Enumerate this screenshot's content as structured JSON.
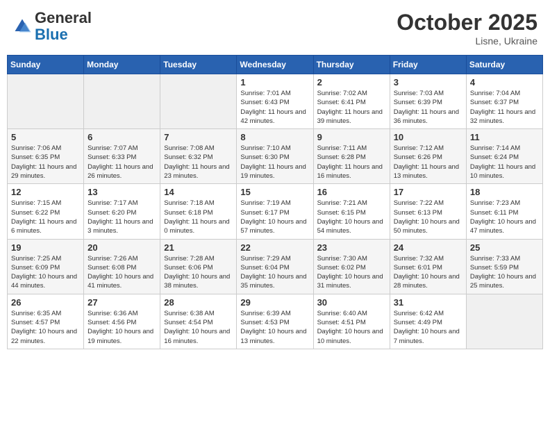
{
  "header": {
    "logo": {
      "line1": "General",
      "line2": "Blue"
    },
    "title": "October 2025",
    "location": "Lisne, Ukraine"
  },
  "weekdays": [
    "Sunday",
    "Monday",
    "Tuesday",
    "Wednesday",
    "Thursday",
    "Friday",
    "Saturday"
  ],
  "weeks": [
    [
      {
        "day": "",
        "sunrise": "",
        "sunset": "",
        "daylight": ""
      },
      {
        "day": "",
        "sunrise": "",
        "sunset": "",
        "daylight": ""
      },
      {
        "day": "",
        "sunrise": "",
        "sunset": "",
        "daylight": ""
      },
      {
        "day": "1",
        "sunrise": "Sunrise: 7:01 AM",
        "sunset": "Sunset: 6:43 PM",
        "daylight": "Daylight: 11 hours and 42 minutes."
      },
      {
        "day": "2",
        "sunrise": "Sunrise: 7:02 AM",
        "sunset": "Sunset: 6:41 PM",
        "daylight": "Daylight: 11 hours and 39 minutes."
      },
      {
        "day": "3",
        "sunrise": "Sunrise: 7:03 AM",
        "sunset": "Sunset: 6:39 PM",
        "daylight": "Daylight: 11 hours and 36 minutes."
      },
      {
        "day": "4",
        "sunrise": "Sunrise: 7:04 AM",
        "sunset": "Sunset: 6:37 PM",
        "daylight": "Daylight: 11 hours and 32 minutes."
      }
    ],
    [
      {
        "day": "5",
        "sunrise": "Sunrise: 7:06 AM",
        "sunset": "Sunset: 6:35 PM",
        "daylight": "Daylight: 11 hours and 29 minutes."
      },
      {
        "day": "6",
        "sunrise": "Sunrise: 7:07 AM",
        "sunset": "Sunset: 6:33 PM",
        "daylight": "Daylight: 11 hours and 26 minutes."
      },
      {
        "day": "7",
        "sunrise": "Sunrise: 7:08 AM",
        "sunset": "Sunset: 6:32 PM",
        "daylight": "Daylight: 11 hours and 23 minutes."
      },
      {
        "day": "8",
        "sunrise": "Sunrise: 7:10 AM",
        "sunset": "Sunset: 6:30 PM",
        "daylight": "Daylight: 11 hours and 19 minutes."
      },
      {
        "day": "9",
        "sunrise": "Sunrise: 7:11 AM",
        "sunset": "Sunset: 6:28 PM",
        "daylight": "Daylight: 11 hours and 16 minutes."
      },
      {
        "day": "10",
        "sunrise": "Sunrise: 7:12 AM",
        "sunset": "Sunset: 6:26 PM",
        "daylight": "Daylight: 11 hours and 13 minutes."
      },
      {
        "day": "11",
        "sunrise": "Sunrise: 7:14 AM",
        "sunset": "Sunset: 6:24 PM",
        "daylight": "Daylight: 11 hours and 10 minutes."
      }
    ],
    [
      {
        "day": "12",
        "sunrise": "Sunrise: 7:15 AM",
        "sunset": "Sunset: 6:22 PM",
        "daylight": "Daylight: 11 hours and 6 minutes."
      },
      {
        "day": "13",
        "sunrise": "Sunrise: 7:17 AM",
        "sunset": "Sunset: 6:20 PM",
        "daylight": "Daylight: 11 hours and 3 minutes."
      },
      {
        "day": "14",
        "sunrise": "Sunrise: 7:18 AM",
        "sunset": "Sunset: 6:18 PM",
        "daylight": "Daylight: 11 hours and 0 minutes."
      },
      {
        "day": "15",
        "sunrise": "Sunrise: 7:19 AM",
        "sunset": "Sunset: 6:17 PM",
        "daylight": "Daylight: 10 hours and 57 minutes."
      },
      {
        "day": "16",
        "sunrise": "Sunrise: 7:21 AM",
        "sunset": "Sunset: 6:15 PM",
        "daylight": "Daylight: 10 hours and 54 minutes."
      },
      {
        "day": "17",
        "sunrise": "Sunrise: 7:22 AM",
        "sunset": "Sunset: 6:13 PM",
        "daylight": "Daylight: 10 hours and 50 minutes."
      },
      {
        "day": "18",
        "sunrise": "Sunrise: 7:23 AM",
        "sunset": "Sunset: 6:11 PM",
        "daylight": "Daylight: 10 hours and 47 minutes."
      }
    ],
    [
      {
        "day": "19",
        "sunrise": "Sunrise: 7:25 AM",
        "sunset": "Sunset: 6:09 PM",
        "daylight": "Daylight: 10 hours and 44 minutes."
      },
      {
        "day": "20",
        "sunrise": "Sunrise: 7:26 AM",
        "sunset": "Sunset: 6:08 PM",
        "daylight": "Daylight: 10 hours and 41 minutes."
      },
      {
        "day": "21",
        "sunrise": "Sunrise: 7:28 AM",
        "sunset": "Sunset: 6:06 PM",
        "daylight": "Daylight: 10 hours and 38 minutes."
      },
      {
        "day": "22",
        "sunrise": "Sunrise: 7:29 AM",
        "sunset": "Sunset: 6:04 PM",
        "daylight": "Daylight: 10 hours and 35 minutes."
      },
      {
        "day": "23",
        "sunrise": "Sunrise: 7:30 AM",
        "sunset": "Sunset: 6:02 PM",
        "daylight": "Daylight: 10 hours and 31 minutes."
      },
      {
        "day": "24",
        "sunrise": "Sunrise: 7:32 AM",
        "sunset": "Sunset: 6:01 PM",
        "daylight": "Daylight: 10 hours and 28 minutes."
      },
      {
        "day": "25",
        "sunrise": "Sunrise: 7:33 AM",
        "sunset": "Sunset: 5:59 PM",
        "daylight": "Daylight: 10 hours and 25 minutes."
      }
    ],
    [
      {
        "day": "26",
        "sunrise": "Sunrise: 6:35 AM",
        "sunset": "Sunset: 4:57 PM",
        "daylight": "Daylight: 10 hours and 22 minutes."
      },
      {
        "day": "27",
        "sunrise": "Sunrise: 6:36 AM",
        "sunset": "Sunset: 4:56 PM",
        "daylight": "Daylight: 10 hours and 19 minutes."
      },
      {
        "day": "28",
        "sunrise": "Sunrise: 6:38 AM",
        "sunset": "Sunset: 4:54 PM",
        "daylight": "Daylight: 10 hours and 16 minutes."
      },
      {
        "day": "29",
        "sunrise": "Sunrise: 6:39 AM",
        "sunset": "Sunset: 4:53 PM",
        "daylight": "Daylight: 10 hours and 13 minutes."
      },
      {
        "day": "30",
        "sunrise": "Sunrise: 6:40 AM",
        "sunset": "Sunset: 4:51 PM",
        "daylight": "Daylight: 10 hours and 10 minutes."
      },
      {
        "day": "31",
        "sunrise": "Sunrise: 6:42 AM",
        "sunset": "Sunset: 4:49 PM",
        "daylight": "Daylight: 10 hours and 7 minutes."
      },
      {
        "day": "",
        "sunrise": "",
        "sunset": "",
        "daylight": ""
      }
    ]
  ]
}
